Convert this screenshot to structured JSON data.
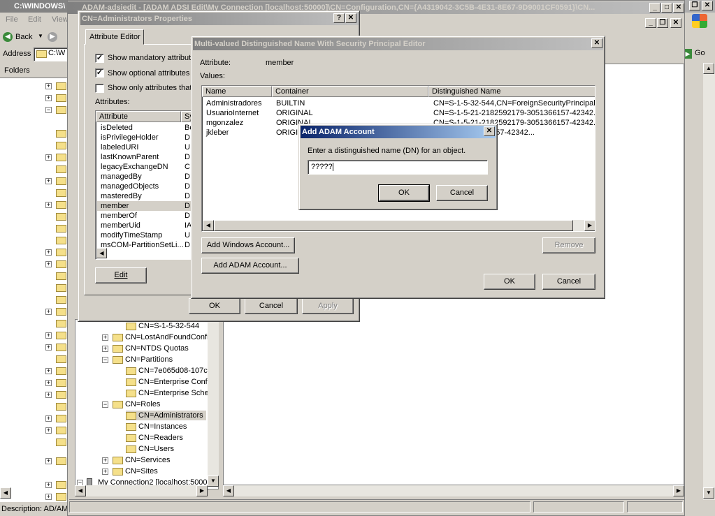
{
  "explorer": {
    "title": "C:\\WINDOWS\\",
    "menu": [
      "File",
      "Edit",
      "View"
    ],
    "back_label": "Back",
    "address_label": "Address",
    "address_value": "C:\\W",
    "folders_label": "Folders",
    "go_label": "Go",
    "status": "Description: AD/AM"
  },
  "adsiedit": {
    "title": "ADAM-adsiedit - [ADAM ADSI Edit\\My Connection [localhost:50000]\\CN=Configuration,CN={A4319042-3C5B-4E31-8E67-9D9001CF0591}\\CN..."
  },
  "tree": {
    "items": [
      "CN=S-1-5-32-544",
      "CN=LostAndFoundConfi",
      "CN=NTDS Quotas",
      "CN=Partitions",
      "CN=7e065d08-107c",
      "CN=Enterprise Conf",
      "CN=Enterprise Sche",
      "CN=Roles",
      "CN=Administrators",
      "CN=Instances",
      "CN=Readers",
      "CN=Users",
      "CN=Services",
      "CN=Sites",
      "My Connection2 [localhost:5000"
    ]
  },
  "props": {
    "title": "CN=Administrators Properties",
    "tab": "Attribute Editor",
    "show_mandatory": "Show mandatory attribute",
    "show_optional": "Show optional attributes",
    "show_only": "Show only attributes that",
    "attributes_label": "Attributes:",
    "col_attribute": "Attribute",
    "col_syntax": "Sy",
    "rows": [
      {
        "name": "isDeleted",
        "syn": "Bo"
      },
      {
        "name": "isPrivilegeHolder",
        "syn": "D"
      },
      {
        "name": "labeledURI",
        "syn": "U"
      },
      {
        "name": "lastKnownParent",
        "syn": "D"
      },
      {
        "name": "legacyExchangeDN",
        "syn": "C"
      },
      {
        "name": "managedBy",
        "syn": "D"
      },
      {
        "name": "managedObjects",
        "syn": "D"
      },
      {
        "name": "masteredBy",
        "syn": "D"
      },
      {
        "name": "member",
        "syn": "D"
      },
      {
        "name": "memberOf",
        "syn": "D"
      },
      {
        "name": "memberUid",
        "syn": "IA"
      },
      {
        "name": "modifyTimeStamp",
        "syn": "U"
      },
      {
        "name": "msCOM-PartitionSetLi...",
        "syn": "D"
      }
    ],
    "edit_label": "Edit",
    "ok_label": "OK",
    "cancel_label": "Cancel",
    "apply_label": "Apply"
  },
  "mv": {
    "title": "Multi-valued Distinguished Name With Security Principal Editor",
    "attribute_label": "Attribute:",
    "attribute_value": "member",
    "values_label": "Values:",
    "col_name": "Name",
    "col_container": "Container",
    "col_dn": "Distinguished Name",
    "rows": [
      {
        "name": "Administradores",
        "container": "BUILTIN",
        "dn": "CN=S-1-5-32-544,CN=ForeignSecurityPrincipal..."
      },
      {
        "name": "UsuarioInternet",
        "container": "ORIGINAL",
        "dn": "CN=S-1-5-21-2182592179-3051366157-42342..."
      },
      {
        "name": "mgonzalez",
        "container": "ORIGINAL",
        "dn": "CN=S-1-5-21-2182592179-3051366157-42342..."
      },
      {
        "name": "jkleber",
        "container": "ORIGIN",
        "dn": "592179-3051366157-42342..."
      }
    ],
    "add_windows": "Add Windows Account...",
    "add_adam": "Add ADAM Account...",
    "remove": "Remove",
    "ok": "OK",
    "cancel": "Cancel"
  },
  "adam": {
    "title": "Add ADAM Account",
    "prompt": "Enter a distinguished name (DN) for an object.",
    "input_value": "?????",
    "ok": "OK",
    "cancel": "Cancel"
  }
}
